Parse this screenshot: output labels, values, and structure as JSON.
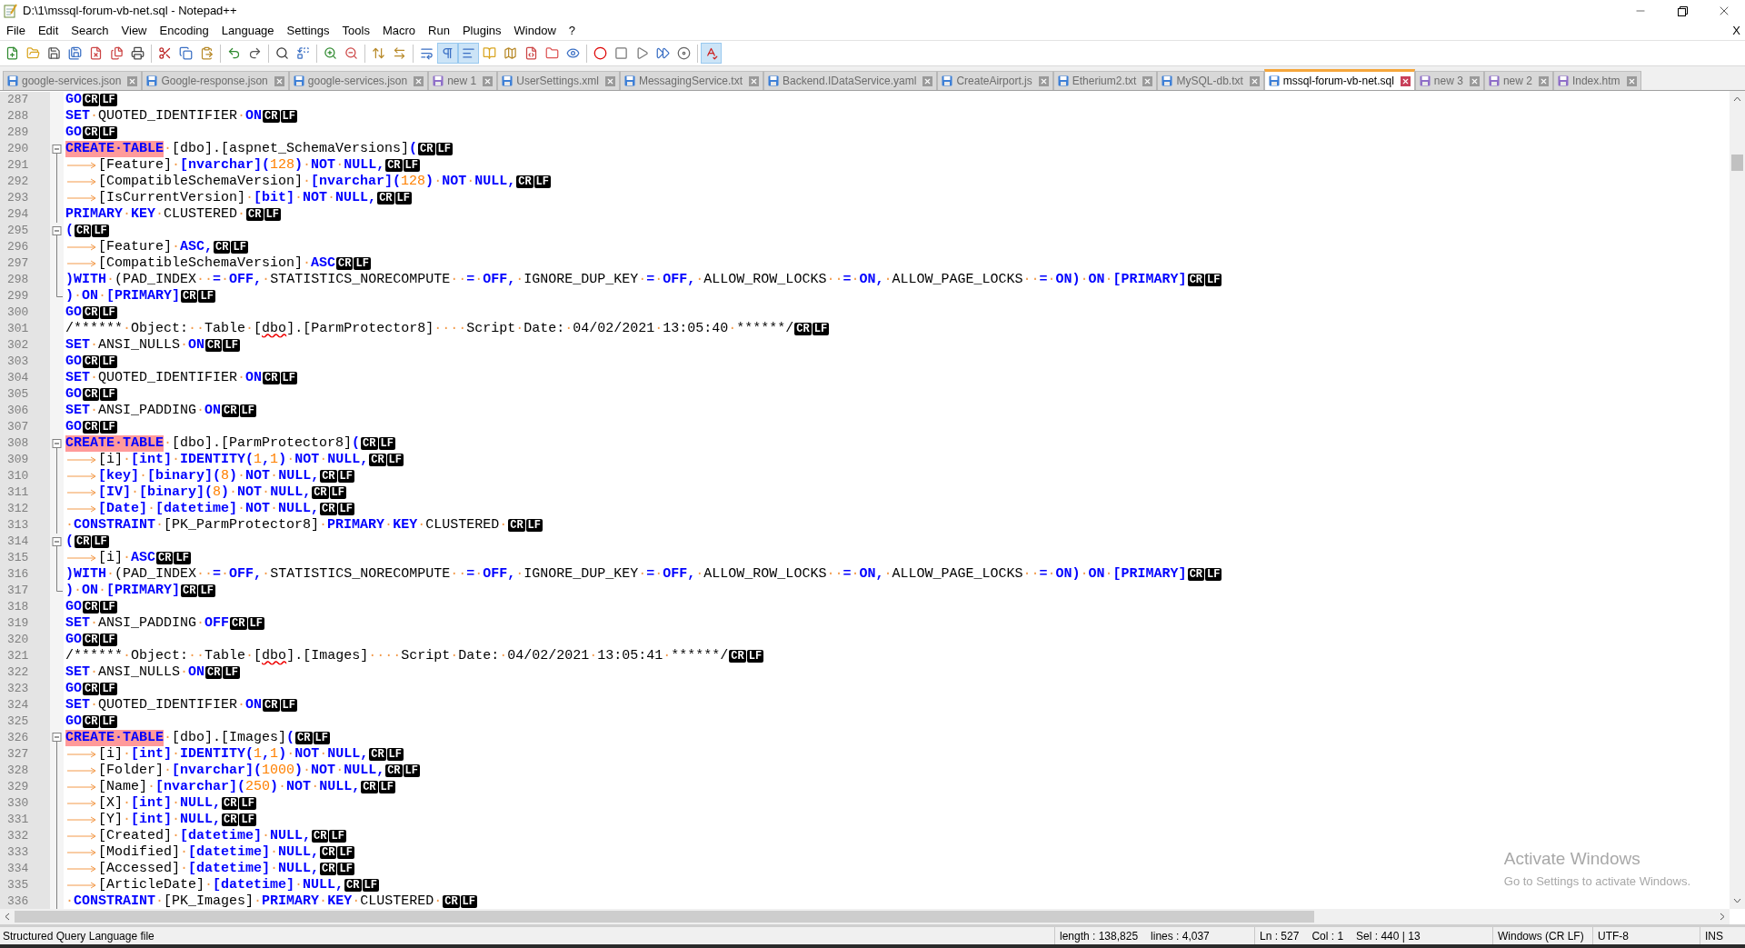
{
  "window": {
    "title": "D:\\1\\mssql-forum-vb-net.sql - Notepad++"
  },
  "menu": {
    "items": [
      "File",
      "Edit",
      "Search",
      "View",
      "Encoding",
      "Language",
      "Settings",
      "Tools",
      "Macro",
      "Run",
      "Plugins",
      "Window",
      "?"
    ],
    "close_label": "X"
  },
  "toolbar": [
    {
      "pressed": false
    },
    {
      "pressed": false
    },
    {
      "pressed": false
    },
    {
      "pressed": false
    },
    {
      "pressed": false
    },
    {
      "pressed": false
    },
    {
      "pressed": false
    },
    {
      "pressed": false
    },
    {
      "pressed": false
    },
    {
      "pressed": false
    },
    {
      "pressed": false
    },
    {
      "pressed": false
    },
    {
      "pressed": false
    },
    {
      "pressed": false
    },
    {
      "pressed": false
    },
    {
      "pressed": false
    },
    {
      "pressed": false
    },
    {
      "pressed": false
    },
    {
      "pressed": false
    },
    {
      "pressed": true
    },
    {
      "pressed": true
    },
    {
      "pressed": false
    },
    {
      "pressed": false
    },
    {
      "pressed": false
    },
    {
      "pressed": false
    },
    {
      "pressed": false
    },
    {
      "pressed": false
    },
    {
      "pressed": false
    },
    {
      "pressed": false
    },
    {
      "pressed": false
    },
    {
      "pressed": false
    },
    {
      "pressed": true
    }
  ],
  "tabs": [
    {
      "label": "google-services.json",
      "selected": false,
      "color": "#3d7fd6"
    },
    {
      "label": "Google-response.json",
      "selected": false,
      "color": "#3d7fd6"
    },
    {
      "label": "google-services.json",
      "selected": false,
      "color": "#3d7fd6"
    },
    {
      "label": "new 1",
      "selected": false,
      "color": "#8e6ec8"
    },
    {
      "label": "UserSettings.xml",
      "selected": false,
      "color": "#3d7fd6"
    },
    {
      "label": "MessagingService.txt",
      "selected": false,
      "color": "#3d7fd6"
    },
    {
      "label": "Backend.IDataService.yaml",
      "selected": false,
      "color": "#3d7fd6"
    },
    {
      "label": "CreateAirport.js",
      "selected": false,
      "color": "#3d7fd6"
    },
    {
      "label": "Etherium2.txt",
      "selected": false,
      "color": "#3d7fd6"
    },
    {
      "label": "MySQL-db.txt",
      "selected": false,
      "color": "#3d7fd6"
    },
    {
      "label": "mssql-forum-vb-net.sql",
      "selected": true,
      "color": "#3d7fd6"
    },
    {
      "label": "new 3",
      "selected": false,
      "color": "#8e6ec8"
    },
    {
      "label": "new 2",
      "selected": false,
      "color": "#8e6ec8"
    },
    {
      "label": "Index.htm",
      "selected": false,
      "color": "#8e6ec8"
    }
  ],
  "editor": {
    "lines": [
      {
        "number": "287",
        "kind": "plain",
        "tokens": [
          {
            "kind": "keyword",
            "text": "GO"
          }
        ],
        "eol": [
          "CR",
          "LF"
        ]
      },
      {
        "number": "288",
        "kind": "plain",
        "tokens": [
          {
            "kind": "keyword",
            "text": "SET"
          },
          {
            "kind": "space",
            "text": "·"
          },
          {
            "kind": "plain",
            "text": "QUOTED_IDENTIFIER"
          },
          {
            "kind": "space",
            "text": "·"
          },
          {
            "kind": "keyword",
            "text": "ON"
          }
        ],
        "eol": [
          "CR",
          "LF"
        ]
      },
      {
        "number": "289",
        "kind": "plain",
        "tokens": [
          {
            "kind": "keyword",
            "text": "GO"
          }
        ],
        "eol": [
          "CR",
          "LF"
        ]
      },
      {
        "number": "290",
        "kind": "fold-start",
        "tokens": [
          {
            "kind": "highlight",
            "text": "CREATE·TABLE"
          },
          {
            "kind": "space",
            "text": "·"
          },
          {
            "kind": "plain",
            "text": "[dbo].[aspnet_SchemaVersions]"
          },
          {
            "kind": "keyword",
            "text": "("
          }
        ],
        "eol": [
          "CR",
          "LF"
        ]
      },
      {
        "number": "291",
        "kind": "fold-body",
        "tokens": [
          {
            "kind": "tab"
          },
          {
            "kind": "plain",
            "text": "[Feature]"
          },
          {
            "kind": "space",
            "text": "·"
          },
          {
            "kind": "keyword",
            "text": "[nvarchar]("
          },
          {
            "kind": "number",
            "text": "128"
          },
          {
            "kind": "keyword",
            "text": ")"
          },
          {
            "kind": "space",
            "text": "·"
          },
          {
            "kind": "keyword",
            "text": "NOT"
          },
          {
            "kind": "space",
            "text": "·"
          },
          {
            "kind": "keyword",
            "text": "NULL,"
          }
        ],
        "eol": [
          "CR",
          "LF"
        ]
      },
      {
        "number": "292",
        "kind": "fold-body",
        "tokens": [
          {
            "kind": "tab"
          },
          {
            "kind": "plain",
            "text": "[CompatibleSchemaVersion]"
          },
          {
            "kind": "space",
            "text": "·"
          },
          {
            "kind": "keyword",
            "text": "[nvarchar]("
          },
          {
            "kind": "number",
            "text": "128"
          },
          {
            "kind": "keyword",
            "text": ")"
          },
          {
            "kind": "space",
            "text": "·"
          },
          {
            "kind": "keyword",
            "text": "NOT"
          },
          {
            "kind": "space",
            "text": "·"
          },
          {
            "kind": "keyword",
            "text": "NULL,"
          }
        ],
        "eol": [
          "CR",
          "LF"
        ]
      },
      {
        "number": "293",
        "kind": "fold-body",
        "tokens": [
          {
            "kind": "tab"
          },
          {
            "kind": "plain",
            "text": "[IsCurrentVersion]"
          },
          {
            "kind": "space",
            "text": "·"
          },
          {
            "kind": "keyword",
            "text": "[bit]"
          },
          {
            "kind": "space",
            "text": "·"
          },
          {
            "kind": "keyword",
            "text": "NOT"
          },
          {
            "kind": "space",
            "text": "·"
          },
          {
            "kind": "keyword",
            "text": "NULL,"
          }
        ],
        "eol": [
          "CR",
          "LF"
        ]
      },
      {
        "number": "294",
        "kind": "fold-body",
        "tokens": [
          {
            "kind": "keyword",
            "text": "PRIMARY"
          },
          {
            "kind": "space",
            "text": "·"
          },
          {
            "kind": "keyword",
            "text": "KEY"
          },
          {
            "kind": "space",
            "text": "·"
          },
          {
            "kind": "plain",
            "text": "CLUSTERED"
          },
          {
            "kind": "space",
            "text": "·"
          }
        ],
        "eol": [
          "CR",
          "LF"
        ]
      },
      {
        "number": "295",
        "kind": "fold-start",
        "tokens": [
          {
            "kind": "keyword",
            "text": "("
          }
        ],
        "eol": [
          "CR",
          "LF"
        ]
      },
      {
        "number": "296",
        "kind": "fold-body",
        "tokens": [
          {
            "kind": "tab"
          },
          {
            "kind": "plain",
            "text": "[Feature]"
          },
          {
            "kind": "space",
            "text": "·"
          },
          {
            "kind": "keyword",
            "text": "ASC,"
          }
        ],
        "eol": [
          "CR",
          "LF"
        ]
      },
      {
        "number": "297",
        "kind": "fold-body",
        "tokens": [
          {
            "kind": "tab"
          },
          {
            "kind": "plain",
            "text": "[CompatibleSchemaVersion]"
          },
          {
            "kind": "space",
            "text": "·"
          },
          {
            "kind": "keyword",
            "text": "ASC"
          }
        ],
        "eol": [
          "CR",
          "LF"
        ]
      },
      {
        "number": "298",
        "kind": "fold-body",
        "tokens": [
          {
            "kind": "keyword",
            "text": ")WITH"
          },
          {
            "kind": "space",
            "text": "·"
          },
          {
            "kind": "plain",
            "text": "(PAD_INDEX"
          },
          {
            "kind": "space",
            "text": "··"
          },
          {
            "kind": "keyword",
            "text": "="
          },
          {
            "kind": "space",
            "text": "·"
          },
          {
            "kind": "keyword",
            "text": "OFF,"
          },
          {
            "kind": "space",
            "text": "·"
          },
          {
            "kind": "plain",
            "text": "STATISTICS_NORECOMPUTE"
          },
          {
            "kind": "space",
            "text": "··"
          },
          {
            "kind": "keyword",
            "text": "="
          },
          {
            "kind": "space",
            "text": "·"
          },
          {
            "kind": "keyword",
            "text": "OFF,"
          },
          {
            "kind": "space",
            "text": "·"
          },
          {
            "kind": "plain",
            "text": "IGNORE_DUP_KEY"
          },
          {
            "kind": "space",
            "text": "·"
          },
          {
            "kind": "keyword",
            "text": "="
          },
          {
            "kind": "space",
            "text": "·"
          },
          {
            "kind": "keyword",
            "text": "OFF,"
          },
          {
            "kind": "space",
            "text": "·"
          },
          {
            "kind": "plain",
            "text": "ALLOW_ROW_LOCKS"
          },
          {
            "kind": "space",
            "text": "··"
          },
          {
            "kind": "keyword",
            "text": "="
          },
          {
            "kind": "space",
            "text": "·"
          },
          {
            "kind": "keyword",
            "text": "ON,"
          },
          {
            "kind": "space",
            "text": "·"
          },
          {
            "kind": "plain",
            "text": "ALLOW_PAGE_LOCKS"
          },
          {
            "kind": "space",
            "text": "··"
          },
          {
            "kind": "keyword",
            "text": "="
          },
          {
            "kind": "space",
            "text": "·"
          },
          {
            "kind": "keyword",
            "text": "ON)"
          },
          {
            "kind": "space",
            "text": "·"
          },
          {
            "kind": "keyword",
            "text": "ON"
          },
          {
            "kind": "space",
            "text": "·"
          },
          {
            "kind": "keyword",
            "text": "[PRIMARY]"
          }
        ],
        "eol": [
          "CR",
          "LF"
        ]
      },
      {
        "number": "299",
        "kind": "fold-end",
        "tokens": [
          {
            "kind": "keyword",
            "text": ")"
          },
          {
            "kind": "space",
            "text": "·"
          },
          {
            "kind": "keyword",
            "text": "ON"
          },
          {
            "kind": "space",
            "text": "·"
          },
          {
            "kind": "keyword",
            "text": "[PRIMARY]"
          }
        ],
        "eol": [
          "CR",
          "LF"
        ]
      },
      {
        "number": "300",
        "kind": "plain",
        "tokens": [
          {
            "kind": "keyword",
            "text": "GO"
          }
        ],
        "eol": [
          "CR",
          "LF"
        ]
      },
      {
        "number": "301",
        "kind": "plain",
        "tokens": [
          {
            "kind": "plain",
            "text": "/******"
          },
          {
            "kind": "space",
            "text": "·"
          },
          {
            "kind": "plain",
            "text": "Object:"
          },
          {
            "kind": "space",
            "text": "··"
          },
          {
            "kind": "plain",
            "text": "Table"
          },
          {
            "kind": "space",
            "text": "·"
          },
          {
            "kind": "plain",
            "text": "["
          },
          {
            "kind": "misspelled",
            "text": "dbo"
          },
          {
            "kind": "plain",
            "text": "].[ParmProtector8]"
          },
          {
            "kind": "space",
            "text": "····"
          },
          {
            "kind": "plain",
            "text": "Script"
          },
          {
            "kind": "space",
            "text": "·"
          },
          {
            "kind": "plain",
            "text": "Date:"
          },
          {
            "kind": "space",
            "text": "·"
          },
          {
            "kind": "plain",
            "text": "04/02/2021"
          },
          {
            "kind": "space",
            "text": "·"
          },
          {
            "kind": "plain",
            "text": "13:05:40"
          },
          {
            "kind": "space",
            "text": "·"
          },
          {
            "kind": "plain",
            "text": "******/"
          }
        ],
        "eol": [
          "CR",
          "LF"
        ]
      },
      {
        "number": "302",
        "kind": "plain",
        "tokens": [
          {
            "kind": "keyword",
            "text": "SET"
          },
          {
            "kind": "space",
            "text": "·"
          },
          {
            "kind": "plain",
            "text": "ANSI_NULLS"
          },
          {
            "kind": "space",
            "text": "·"
          },
          {
            "kind": "keyword",
            "text": "ON"
          }
        ],
        "eol": [
          "CR",
          "LF"
        ]
      },
      {
        "number": "303",
        "kind": "plain",
        "tokens": [
          {
            "kind": "keyword",
            "text": "GO"
          }
        ],
        "eol": [
          "CR",
          "LF"
        ]
      },
      {
        "number": "304",
        "kind": "plain",
        "tokens": [
          {
            "kind": "keyword",
            "text": "SET"
          },
          {
            "kind": "space",
            "text": "·"
          },
          {
            "kind": "plain",
            "text": "QUOTED_IDENTIFIER"
          },
          {
            "kind": "space",
            "text": "·"
          },
          {
            "kind": "keyword",
            "text": "ON"
          }
        ],
        "eol": [
          "CR",
          "LF"
        ]
      },
      {
        "number": "305",
        "kind": "plain",
        "tokens": [
          {
            "kind": "keyword",
            "text": "GO"
          }
        ],
        "eol": [
          "CR",
          "LF"
        ]
      },
      {
        "number": "306",
        "kind": "plain",
        "tokens": [
          {
            "kind": "keyword",
            "text": "SET"
          },
          {
            "kind": "space",
            "text": "·"
          },
          {
            "kind": "plain",
            "text": "ANSI_PADDING"
          },
          {
            "kind": "space",
            "text": "·"
          },
          {
            "kind": "keyword",
            "text": "ON"
          }
        ],
        "eol": [
          "CR",
          "LF"
        ]
      },
      {
        "number": "307",
        "kind": "plain",
        "tokens": [
          {
            "kind": "keyword",
            "text": "GO"
          }
        ],
        "eol": [
          "CR",
          "LF"
        ]
      },
      {
        "number": "308",
        "kind": "fold-start",
        "tokens": [
          {
            "kind": "highlight",
            "text": "CREATE·TABLE"
          },
          {
            "kind": "space",
            "text": "·"
          },
          {
            "kind": "plain",
            "text": "[dbo].[ParmProtector8]"
          },
          {
            "kind": "keyword",
            "text": "("
          }
        ],
        "eol": [
          "CR",
          "LF"
        ]
      },
      {
        "number": "309",
        "kind": "fold-body",
        "tokens": [
          {
            "kind": "tab"
          },
          {
            "kind": "plain",
            "text": "[i]"
          },
          {
            "kind": "space",
            "text": "·"
          },
          {
            "kind": "keyword",
            "text": "[int]"
          },
          {
            "kind": "space",
            "text": "·"
          },
          {
            "kind": "keyword",
            "text": "IDENTITY("
          },
          {
            "kind": "number",
            "text": "1"
          },
          {
            "kind": "keyword",
            "text": ","
          },
          {
            "kind": "number",
            "text": "1"
          },
          {
            "kind": "keyword",
            "text": ")"
          },
          {
            "kind": "space",
            "text": "·"
          },
          {
            "kind": "keyword",
            "text": "NOT"
          },
          {
            "kind": "space",
            "text": "·"
          },
          {
            "kind": "keyword",
            "text": "NULL,"
          }
        ],
        "eol": [
          "CR",
          "LF"
        ]
      },
      {
        "number": "310",
        "kind": "fold-body",
        "tokens": [
          {
            "kind": "tab"
          },
          {
            "kind": "keyword",
            "text": "[key]"
          },
          {
            "kind": "space",
            "text": "·"
          },
          {
            "kind": "keyword",
            "text": "[binary]("
          },
          {
            "kind": "number",
            "text": "8"
          },
          {
            "kind": "keyword",
            "text": ")"
          },
          {
            "kind": "space",
            "text": "·"
          },
          {
            "kind": "keyword",
            "text": "NOT"
          },
          {
            "kind": "space",
            "text": "·"
          },
          {
            "kind": "keyword",
            "text": "NULL,"
          }
        ],
        "eol": [
          "CR",
          "LF"
        ]
      },
      {
        "number": "311",
        "kind": "fold-body",
        "tokens": [
          {
            "kind": "tab"
          },
          {
            "kind": "keyword",
            "text": "[IV]"
          },
          {
            "kind": "space",
            "text": "·"
          },
          {
            "kind": "keyword",
            "text": "[binary]("
          },
          {
            "kind": "number",
            "text": "8"
          },
          {
            "kind": "keyword",
            "text": ")"
          },
          {
            "kind": "space",
            "text": "·"
          },
          {
            "kind": "keyword",
            "text": "NOT"
          },
          {
            "kind": "space",
            "text": "·"
          },
          {
            "kind": "keyword",
            "text": "NULL,"
          }
        ],
        "eol": [
          "CR",
          "LF"
        ]
      },
      {
        "number": "312",
        "kind": "fold-body",
        "tokens": [
          {
            "kind": "tab"
          },
          {
            "kind": "keyword",
            "text": "[Date]"
          },
          {
            "kind": "space",
            "text": "·"
          },
          {
            "kind": "keyword",
            "text": "[datetime]"
          },
          {
            "kind": "space",
            "text": "·"
          },
          {
            "kind": "keyword",
            "text": "NOT"
          },
          {
            "kind": "space",
            "text": "·"
          },
          {
            "kind": "keyword",
            "text": "NULL,"
          }
        ],
        "eol": [
          "CR",
          "LF"
        ]
      },
      {
        "number": "313",
        "kind": "fold-body",
        "tokens": [
          {
            "kind": "space",
            "text": "·"
          },
          {
            "kind": "keyword",
            "text": "CONSTRAINT"
          },
          {
            "kind": "space",
            "text": "·"
          },
          {
            "kind": "plain",
            "text": "[PK_ParmProtector8]"
          },
          {
            "kind": "space",
            "text": "·"
          },
          {
            "kind": "keyword",
            "text": "PRIMARY"
          },
          {
            "kind": "space",
            "text": "·"
          },
          {
            "kind": "keyword",
            "text": "KEY"
          },
          {
            "kind": "space",
            "text": "·"
          },
          {
            "kind": "plain",
            "text": "CLUSTERED"
          },
          {
            "kind": "space",
            "text": "·"
          }
        ],
        "eol": [
          "CR",
          "LF"
        ]
      },
      {
        "number": "314",
        "kind": "fold-start",
        "tokens": [
          {
            "kind": "keyword",
            "text": "("
          }
        ],
        "eol": [
          "CR",
          "LF"
        ]
      },
      {
        "number": "315",
        "kind": "fold-body",
        "tokens": [
          {
            "kind": "tab"
          },
          {
            "kind": "plain",
            "text": "[i]"
          },
          {
            "kind": "space",
            "text": "·"
          },
          {
            "kind": "keyword",
            "text": "ASC"
          }
        ],
        "eol": [
          "CR",
          "LF"
        ]
      },
      {
        "number": "316",
        "kind": "fold-body",
        "tokens": [
          {
            "kind": "keyword",
            "text": ")WITH"
          },
          {
            "kind": "space",
            "text": "·"
          },
          {
            "kind": "plain",
            "text": "(PAD_INDEX"
          },
          {
            "kind": "space",
            "text": "··"
          },
          {
            "kind": "keyword",
            "text": "="
          },
          {
            "kind": "space",
            "text": "·"
          },
          {
            "kind": "keyword",
            "text": "OFF,"
          },
          {
            "kind": "space",
            "text": "·"
          },
          {
            "kind": "plain",
            "text": "STATISTICS_NORECOMPUTE"
          },
          {
            "kind": "space",
            "text": "··"
          },
          {
            "kind": "keyword",
            "text": "="
          },
          {
            "kind": "space",
            "text": "·"
          },
          {
            "kind": "keyword",
            "text": "OFF,"
          },
          {
            "kind": "space",
            "text": "·"
          },
          {
            "kind": "plain",
            "text": "IGNORE_DUP_KEY"
          },
          {
            "kind": "space",
            "text": "·"
          },
          {
            "kind": "keyword",
            "text": "="
          },
          {
            "kind": "space",
            "text": "·"
          },
          {
            "kind": "keyword",
            "text": "OFF,"
          },
          {
            "kind": "space",
            "text": "·"
          },
          {
            "kind": "plain",
            "text": "ALLOW_ROW_LOCKS"
          },
          {
            "kind": "space",
            "text": "··"
          },
          {
            "kind": "keyword",
            "text": "="
          },
          {
            "kind": "space",
            "text": "·"
          },
          {
            "kind": "keyword",
            "text": "ON,"
          },
          {
            "kind": "space",
            "text": "·"
          },
          {
            "kind": "plain",
            "text": "ALLOW_PAGE_LOCKS"
          },
          {
            "kind": "space",
            "text": "··"
          },
          {
            "kind": "keyword",
            "text": "="
          },
          {
            "kind": "space",
            "text": "·"
          },
          {
            "kind": "keyword",
            "text": "ON)"
          },
          {
            "kind": "space",
            "text": "·"
          },
          {
            "kind": "keyword",
            "text": "ON"
          },
          {
            "kind": "space",
            "text": "·"
          },
          {
            "kind": "keyword",
            "text": "[PRIMARY]"
          }
        ],
        "eol": [
          "CR",
          "LF"
        ]
      },
      {
        "number": "317",
        "kind": "fold-end",
        "tokens": [
          {
            "kind": "keyword",
            "text": ")"
          },
          {
            "kind": "space",
            "text": "·"
          },
          {
            "kind": "keyword",
            "text": "ON"
          },
          {
            "kind": "space",
            "text": "·"
          },
          {
            "kind": "keyword",
            "text": "[PRIMARY]"
          }
        ],
        "eol": [
          "CR",
          "LF"
        ]
      },
      {
        "number": "318",
        "kind": "plain",
        "tokens": [
          {
            "kind": "keyword",
            "text": "GO"
          }
        ],
        "eol": [
          "CR",
          "LF"
        ]
      },
      {
        "number": "319",
        "kind": "plain",
        "tokens": [
          {
            "kind": "keyword",
            "text": "SET"
          },
          {
            "kind": "space",
            "text": "·"
          },
          {
            "kind": "plain",
            "text": "ANSI_PADDING"
          },
          {
            "kind": "space",
            "text": "·"
          },
          {
            "kind": "keyword",
            "text": "OFF"
          }
        ],
        "eol": [
          "CR",
          "LF"
        ]
      },
      {
        "number": "320",
        "kind": "plain",
        "tokens": [
          {
            "kind": "keyword",
            "text": "GO"
          }
        ],
        "eol": [
          "CR",
          "LF"
        ]
      },
      {
        "number": "321",
        "kind": "plain",
        "tokens": [
          {
            "kind": "plain",
            "text": "/******"
          },
          {
            "kind": "space",
            "text": "·"
          },
          {
            "kind": "plain",
            "text": "Object:"
          },
          {
            "kind": "space",
            "text": "··"
          },
          {
            "kind": "plain",
            "text": "Table"
          },
          {
            "kind": "space",
            "text": "·"
          },
          {
            "kind": "plain",
            "text": "["
          },
          {
            "kind": "misspelled",
            "text": "dbo"
          },
          {
            "kind": "plain",
            "text": "].[Images]"
          },
          {
            "kind": "space",
            "text": "····"
          },
          {
            "kind": "plain",
            "text": "Script"
          },
          {
            "kind": "space",
            "text": "·"
          },
          {
            "kind": "plain",
            "text": "Date:"
          },
          {
            "kind": "space",
            "text": "·"
          },
          {
            "kind": "plain",
            "text": "04/02/2021"
          },
          {
            "kind": "space",
            "text": "·"
          },
          {
            "kind": "plain",
            "text": "13:05:41"
          },
          {
            "kind": "space",
            "text": "·"
          },
          {
            "kind": "plain",
            "text": "******/"
          }
        ],
        "eol": [
          "CR",
          "LF"
        ]
      },
      {
        "number": "322",
        "kind": "plain",
        "tokens": [
          {
            "kind": "keyword",
            "text": "SET"
          },
          {
            "kind": "space",
            "text": "·"
          },
          {
            "kind": "plain",
            "text": "ANSI_NULLS"
          },
          {
            "kind": "space",
            "text": "·"
          },
          {
            "kind": "keyword",
            "text": "ON"
          }
        ],
        "eol": [
          "CR",
          "LF"
        ]
      },
      {
        "number": "323",
        "kind": "plain",
        "tokens": [
          {
            "kind": "keyword",
            "text": "GO"
          }
        ],
        "eol": [
          "CR",
          "LF"
        ]
      },
      {
        "number": "324",
        "kind": "plain",
        "tokens": [
          {
            "kind": "keyword",
            "text": "SET"
          },
          {
            "kind": "space",
            "text": "·"
          },
          {
            "kind": "plain",
            "text": "QUOTED_IDENTIFIER"
          },
          {
            "kind": "space",
            "text": "·"
          },
          {
            "kind": "keyword",
            "text": "ON"
          }
        ],
        "eol": [
          "CR",
          "LF"
        ]
      },
      {
        "number": "325",
        "kind": "plain",
        "tokens": [
          {
            "kind": "keyword",
            "text": "GO"
          }
        ],
        "eol": [
          "CR",
          "LF"
        ]
      },
      {
        "number": "326",
        "kind": "fold-start",
        "tokens": [
          {
            "kind": "highlight",
            "text": "CREATE·TABLE"
          },
          {
            "kind": "space",
            "text": "·"
          },
          {
            "kind": "plain",
            "text": "[dbo].[Images]"
          },
          {
            "kind": "keyword",
            "text": "("
          }
        ],
        "eol": [
          "CR",
          "LF"
        ]
      },
      {
        "number": "327",
        "kind": "fold-body",
        "tokens": [
          {
            "kind": "tab"
          },
          {
            "kind": "plain",
            "text": "[i]"
          },
          {
            "kind": "space",
            "text": "·"
          },
          {
            "kind": "keyword",
            "text": "[int]"
          },
          {
            "kind": "space",
            "text": "·"
          },
          {
            "kind": "keyword",
            "text": "IDENTITY("
          },
          {
            "kind": "number",
            "text": "1"
          },
          {
            "kind": "keyword",
            "text": ","
          },
          {
            "kind": "number",
            "text": "1"
          },
          {
            "kind": "keyword",
            "text": ")"
          },
          {
            "kind": "space",
            "text": "·"
          },
          {
            "kind": "keyword",
            "text": "NOT"
          },
          {
            "kind": "space",
            "text": "·"
          },
          {
            "kind": "keyword",
            "text": "NULL,"
          }
        ],
        "eol": [
          "CR",
          "LF"
        ]
      },
      {
        "number": "328",
        "kind": "fold-body",
        "tokens": [
          {
            "kind": "tab"
          },
          {
            "kind": "plain",
            "text": "[Folder]"
          },
          {
            "kind": "space",
            "text": "·"
          },
          {
            "kind": "keyword",
            "text": "[nvarchar]("
          },
          {
            "kind": "number",
            "text": "1000"
          },
          {
            "kind": "keyword",
            "text": ")"
          },
          {
            "kind": "space",
            "text": "·"
          },
          {
            "kind": "keyword",
            "text": "NOT"
          },
          {
            "kind": "space",
            "text": "·"
          },
          {
            "kind": "keyword",
            "text": "NULL,"
          }
        ],
        "eol": [
          "CR",
          "LF"
        ]
      },
      {
        "number": "329",
        "kind": "fold-body",
        "tokens": [
          {
            "kind": "tab"
          },
          {
            "kind": "plain",
            "text": "[Name]"
          },
          {
            "kind": "space",
            "text": "·"
          },
          {
            "kind": "keyword",
            "text": "[nvarchar]("
          },
          {
            "kind": "number",
            "text": "250"
          },
          {
            "kind": "keyword",
            "text": ")"
          },
          {
            "kind": "space",
            "text": "·"
          },
          {
            "kind": "keyword",
            "text": "NOT"
          },
          {
            "kind": "space",
            "text": "·"
          },
          {
            "kind": "keyword",
            "text": "NULL,"
          }
        ],
        "eol": [
          "CR",
          "LF"
        ]
      },
      {
        "number": "330",
        "kind": "fold-body",
        "tokens": [
          {
            "kind": "tab"
          },
          {
            "kind": "plain",
            "text": "[X]"
          },
          {
            "kind": "space",
            "text": "·"
          },
          {
            "kind": "keyword",
            "text": "[int]"
          },
          {
            "kind": "space",
            "text": "·"
          },
          {
            "kind": "keyword",
            "text": "NULL,"
          }
        ],
        "eol": [
          "CR",
          "LF"
        ]
      },
      {
        "number": "331",
        "kind": "fold-body",
        "tokens": [
          {
            "kind": "tab"
          },
          {
            "kind": "plain",
            "text": "[Y]"
          },
          {
            "kind": "space",
            "text": "·"
          },
          {
            "kind": "keyword",
            "text": "[int]"
          },
          {
            "kind": "space",
            "text": "·"
          },
          {
            "kind": "keyword",
            "text": "NULL,"
          }
        ],
        "eol": [
          "CR",
          "LF"
        ]
      },
      {
        "number": "332",
        "kind": "fold-body",
        "tokens": [
          {
            "kind": "tab"
          },
          {
            "kind": "plain",
            "text": "[Created]"
          },
          {
            "kind": "space",
            "text": "·"
          },
          {
            "kind": "keyword",
            "text": "[datetime]"
          },
          {
            "kind": "space",
            "text": "·"
          },
          {
            "kind": "keyword",
            "text": "NULL,"
          }
        ],
        "eol": [
          "CR",
          "LF"
        ]
      },
      {
        "number": "333",
        "kind": "fold-body",
        "tokens": [
          {
            "kind": "tab"
          },
          {
            "kind": "plain",
            "text": "[Modified]"
          },
          {
            "kind": "space",
            "text": "·"
          },
          {
            "kind": "keyword",
            "text": "[datetime]"
          },
          {
            "kind": "space",
            "text": "·"
          },
          {
            "kind": "keyword",
            "text": "NULL,"
          }
        ],
        "eol": [
          "CR",
          "LF"
        ]
      },
      {
        "number": "334",
        "kind": "fold-body",
        "tokens": [
          {
            "kind": "tab"
          },
          {
            "kind": "plain",
            "text": "[Accessed]"
          },
          {
            "kind": "space",
            "text": "·"
          },
          {
            "kind": "keyword",
            "text": "[datetime]"
          },
          {
            "kind": "space",
            "text": "·"
          },
          {
            "kind": "keyword",
            "text": "NULL,"
          }
        ],
        "eol": [
          "CR",
          "LF"
        ]
      },
      {
        "number": "335",
        "kind": "fold-body",
        "tokens": [
          {
            "kind": "tab"
          },
          {
            "kind": "plain",
            "text": "[ArticleDate]"
          },
          {
            "kind": "space",
            "text": "·"
          },
          {
            "kind": "keyword",
            "text": "[datetime]"
          },
          {
            "kind": "space",
            "text": "·"
          },
          {
            "kind": "keyword",
            "text": "NULL,"
          }
        ],
        "eol": [
          "CR",
          "LF"
        ]
      },
      {
        "number": "336",
        "kind": "fold-body",
        "tokens": [
          {
            "kind": "space",
            "text": "·"
          },
          {
            "kind": "keyword",
            "text": "CONSTRAINT"
          },
          {
            "kind": "space",
            "text": "·"
          },
          {
            "kind": "plain",
            "text": "[PK_Images]"
          },
          {
            "kind": "space",
            "text": "·"
          },
          {
            "kind": "keyword",
            "text": "PRIMARY"
          },
          {
            "kind": "space",
            "text": "·"
          },
          {
            "kind": "keyword",
            "text": "KEY"
          },
          {
            "kind": "space",
            "text": "·"
          },
          {
            "kind": "plain",
            "text": "CLUSTERED"
          },
          {
            "kind": "space",
            "text": "·"
          }
        ],
        "eol": [
          "CR",
          "LF"
        ]
      }
    ]
  },
  "activation_notice": {
    "title": "Activate Windows",
    "subtitle": "Go to Settings to activate Windows."
  },
  "status_bar": {
    "file_type": "Structured Query Language file",
    "panels": [
      [
        "length : 138,825",
        "lines : 4,037"
      ],
      [
        "Ln : 527",
        "Col : 1",
        "Sel : 440 | 13"
      ],
      [
        "Windows (CR LF)"
      ],
      [
        "UTF-8"
      ],
      [
        "INS"
      ]
    ]
  }
}
